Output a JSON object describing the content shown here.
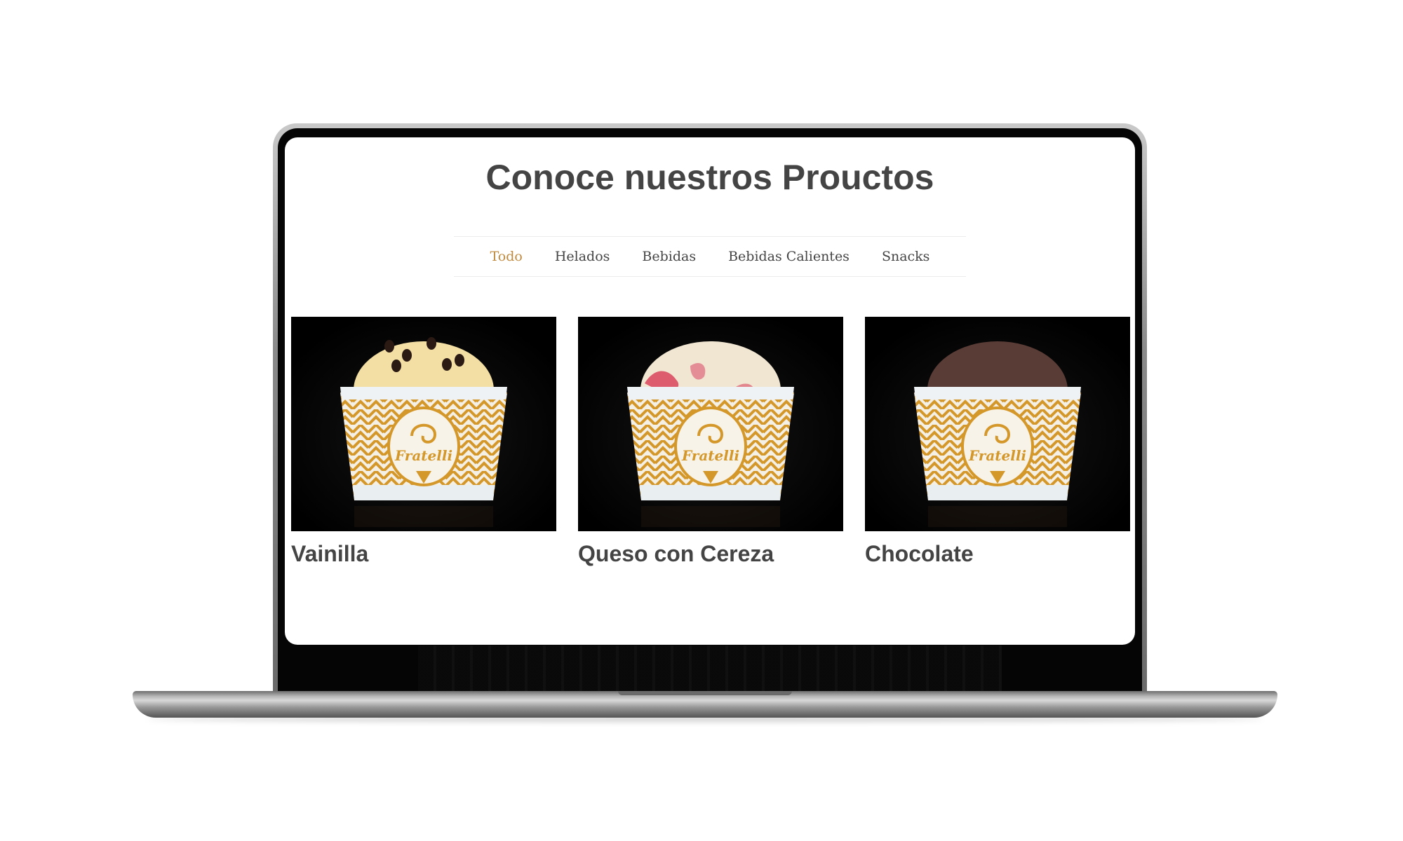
{
  "page": {
    "title": "Conoce nuestros Prouctos"
  },
  "filters": [
    {
      "label": "Todo",
      "active": true
    },
    {
      "label": "Helados",
      "active": false
    },
    {
      "label": "Bebidas",
      "active": false
    },
    {
      "label": "Bebidas Calientes",
      "active": false
    },
    {
      "label": "Snacks",
      "active": false
    }
  ],
  "products": [
    {
      "name": "Vainilla",
      "scoop_color": "#f3dfa4",
      "icon": "ice-cream-cup-icon"
    },
    {
      "name": "Queso con Cereza",
      "scoop_color": "#f1e6d2",
      "icon": "ice-cream-cup-icon"
    },
    {
      "name": "Chocolate",
      "scoop_color": "#5a3c36",
      "icon": "ice-cream-cup-icon"
    }
  ],
  "cup_brand": "Fratelli's",
  "colors": {
    "accent": "#c08a3e",
    "text": "#444444",
    "cup_pattern": "#d4972a"
  }
}
